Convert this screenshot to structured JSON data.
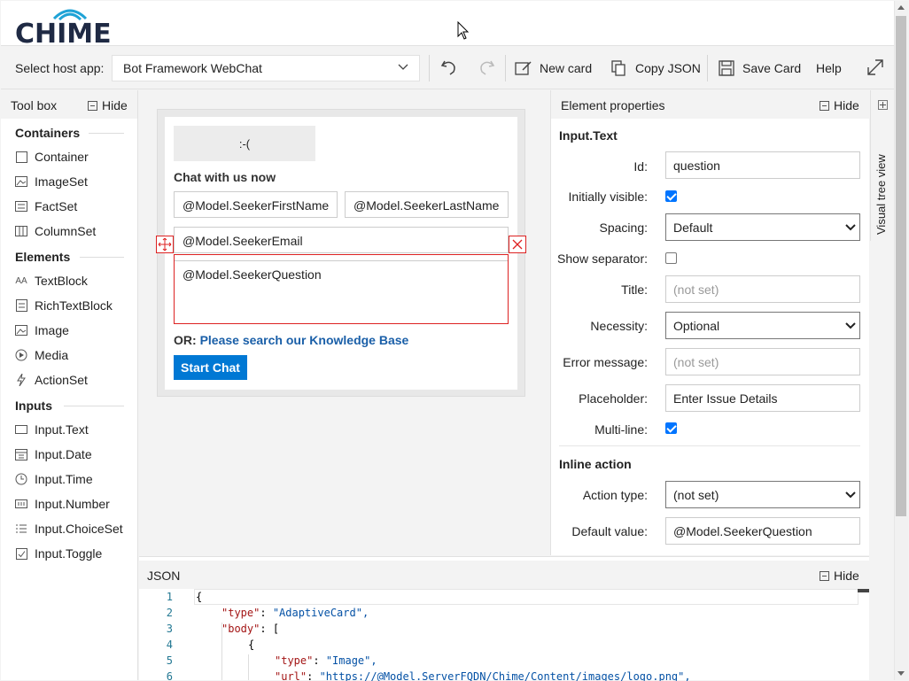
{
  "header": {
    "logo_text": "CHIME"
  },
  "toolbar": {
    "host_label": "Select host app:",
    "host_value": "Bot Framework WebChat",
    "new_card": "New card",
    "copy_json": "Copy JSON",
    "save_card": "Save Card",
    "help": "Help"
  },
  "toolbox": {
    "title": "Tool box",
    "hide": "Hide",
    "sections": [
      {
        "title": "Containers",
        "items": [
          "Container",
          "ImageSet",
          "FactSet",
          "ColumnSet"
        ]
      },
      {
        "title": "Elements",
        "items": [
          "TextBlock",
          "RichTextBlock",
          "Image",
          "Media",
          "ActionSet"
        ]
      },
      {
        "title": "Inputs",
        "items": [
          "Input.Text",
          "Input.Date",
          "Input.Time",
          "Input.Number",
          "Input.ChoiceSet",
          "Input.Toggle"
        ]
      }
    ]
  },
  "card": {
    "image_placeholder": ":-(",
    "heading": "Chat with us now",
    "first_name": "@Model.SeekerFirstName",
    "last_name": "@Model.SeekerLastName",
    "email": "@Model.SeekerEmail",
    "question": "@Model.SeekerQuestion",
    "or_text": "OR:",
    "kb_link": "Please search our Knowledge Base",
    "start_chat": "Start Chat"
  },
  "properties": {
    "title": "Element properties",
    "hide": "Hide",
    "element_type": "Input.Text",
    "id_label": "Id:",
    "id_value": "question",
    "visible_label": "Initially visible:",
    "visible": true,
    "spacing_label": "Spacing:",
    "spacing_value": "Default",
    "separator_label": "Show separator:",
    "separator": false,
    "title_label": "Title:",
    "title_placeholder": "(not set)",
    "necessity_label": "Necessity:",
    "necessity_value": "Optional",
    "error_label": "Error message:",
    "error_placeholder": "(not set)",
    "placeholder_label": "Placeholder:",
    "placeholder_value": "Enter Issue Details",
    "multiline_label": "Multi-line:",
    "multiline": true,
    "inline_section": "Inline action",
    "action_type_label": "Action type:",
    "action_type_value": "(not set)",
    "default_label": "Default value:",
    "default_value": "@Model.SeekerQuestion"
  },
  "tree_view": {
    "label": "Visual tree view"
  },
  "json_panel": {
    "title": "JSON",
    "hide": "Hide",
    "lines": [
      {
        "n": "1",
        "text": "{"
      },
      {
        "n": "2",
        "key": "\"type\"",
        "val": "\"AdaptiveCard\","
      },
      {
        "n": "3",
        "key": "\"body\"",
        "val": "["
      },
      {
        "n": "4",
        "text": "{"
      },
      {
        "n": "5",
        "key": "\"type\"",
        "val": "\"Image\","
      },
      {
        "n": "6",
        "key": "\"url\"",
        "val": "\"https://@Model.ServerFQDN/Chime/Content/images/logo.png\","
      }
    ]
  }
}
